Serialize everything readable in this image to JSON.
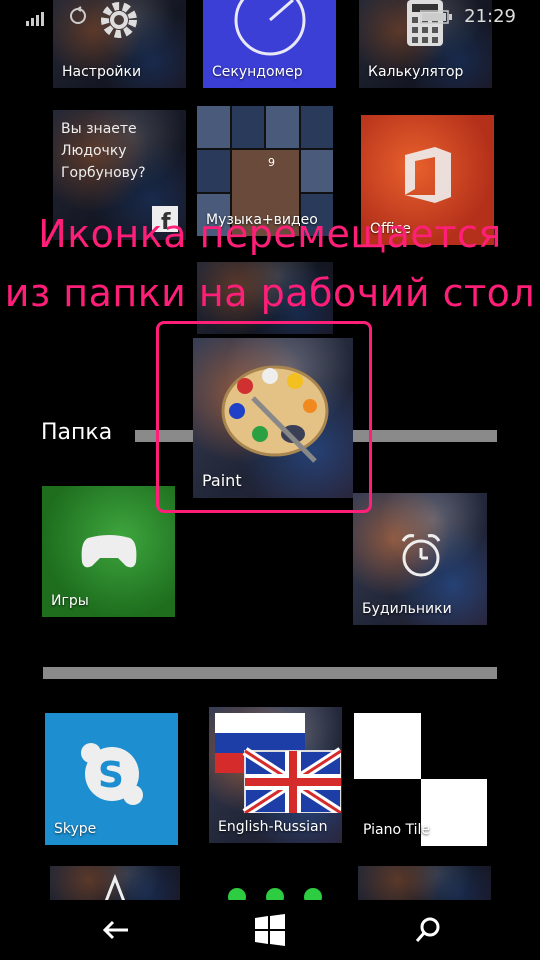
{
  "status_bar": {
    "time": "21:29"
  },
  "tiles_top": [
    {
      "label": "Настройки"
    },
    {
      "label": "Секундомер"
    },
    {
      "label": "Калькулятор"
    }
  ],
  "tiles_row2": {
    "people": {
      "text_lines": [
        "Вы знаете",
        "Людочку",
        "Горбунову?"
      ]
    },
    "music": {
      "label": "Музыка+видео",
      "badge": "9"
    },
    "office": {
      "label": "Office"
    }
  },
  "overlay": {
    "line1": "Иконка перемещается",
    "line2": "из папки на рабочий стол"
  },
  "dragged_tile": {
    "label": "Paint"
  },
  "folder": {
    "title": "Папка",
    "tiles": [
      {
        "label": "Игры"
      },
      {
        "label": "Будильники"
      }
    ]
  },
  "tiles_bottom": [
    {
      "label": "Skype"
    },
    {
      "label": "English-Russian"
    },
    {
      "label": "Piano Tile"
    }
  ],
  "colors": {
    "accent": "#ff1f78",
    "skype": "#1d8fd0",
    "games": "#2e8b2e",
    "stopwatch": "#3b3fd6",
    "office": "#d0401e"
  }
}
